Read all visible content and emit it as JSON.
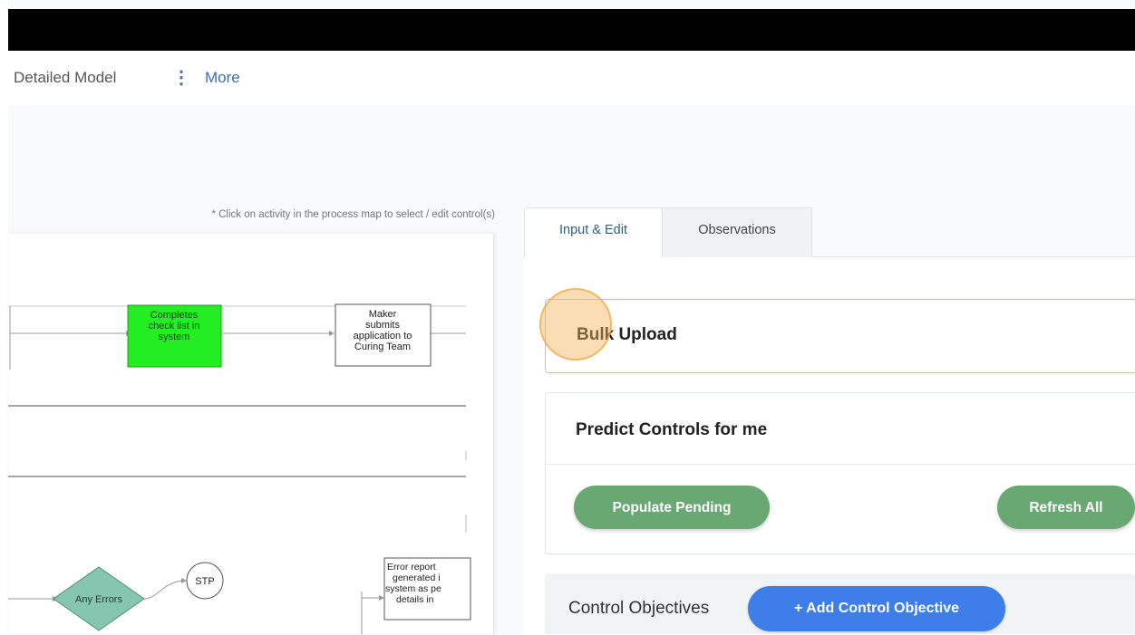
{
  "toolbar": {
    "model_label": "Detailed Model",
    "more_label": "More"
  },
  "hint": {
    "text": "* Click on activity in the process map to select / edit control(s)"
  },
  "process_map": {
    "nodes": {
      "completes": {
        "lines": [
          "Completes",
          "check list in",
          "system"
        ],
        "color": "#22ee22"
      },
      "maker": {
        "lines": [
          "Maker",
          "submits",
          "application to",
          "Curing Team"
        ]
      },
      "any_errors": {
        "label": "Any Errors",
        "color": "#86c6b0"
      },
      "stp": {
        "label": "STP"
      },
      "error_report": {
        "lines": [
          "Error report",
          "generated i",
          "system as pe",
          "details in"
        ]
      }
    }
  },
  "tabs": [
    {
      "label": "Input & Edit"
    },
    {
      "label": "Observations"
    }
  ],
  "bulk_upload": {
    "title": "Bulk Upload"
  },
  "predict": {
    "title": "Predict Controls for me",
    "populate_label": "Populate Pending",
    "refresh_label": "Refresh All"
  },
  "objectives": {
    "label": "Control Objectives",
    "add_label": "+ Add Control Objective"
  },
  "colors": {
    "accent": "#3d7ee8",
    "success": "#69a873"
  }
}
